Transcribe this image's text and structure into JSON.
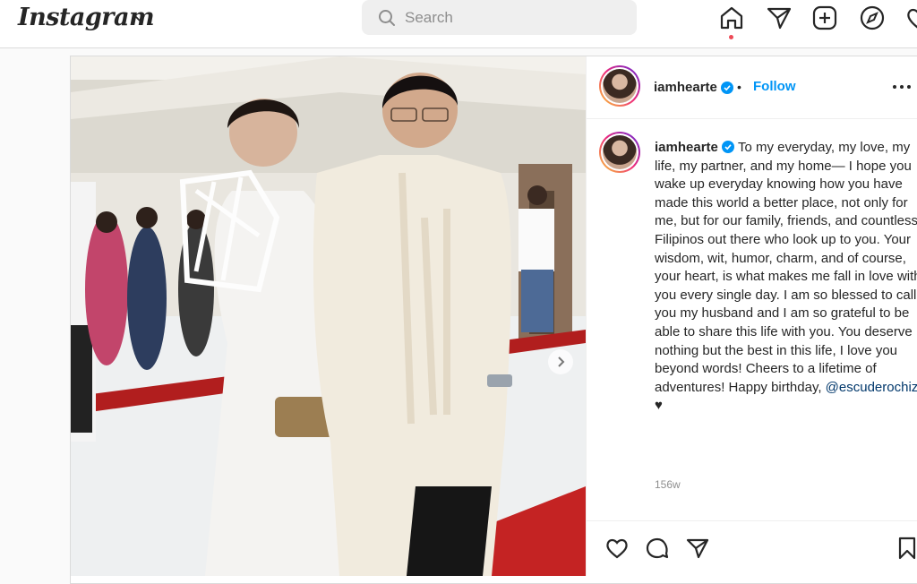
{
  "header": {
    "logo": "Instagram",
    "search_placeholder": "Search",
    "icons": [
      "home-icon",
      "direct-message-icon",
      "new-post-icon",
      "explore-icon",
      "activity-icon"
    ]
  },
  "post": {
    "username": "iamhearte",
    "follow_label": "Follow",
    "caption_user": "iamhearte",
    "caption_text": "To my everyday, my love, my life, my partner, and my home— I hope you wake up everyday knowing how you have made this world a better place, not only for me, but for our family, friends, and countless Filipinos out there who look up to you. Your wisdom, wit, humor, charm, and of course, your heart, is what makes me fall in love with you every single day. I am so blessed to call you my husband and I am so grateful to be able to share this life with you. You deserve nothing but the best in this life, I love you beyond words! Cheers to a lifetime of adventures! Happy birthday,",
    "mention": "@escuderochiz",
    "heart_emoji": "♥",
    "timestamp": "156w"
  },
  "colors": {
    "accent": "#0095f6",
    "text": "#262626",
    "muted": "#8e8e8e",
    "border": "#dbdbdb"
  }
}
